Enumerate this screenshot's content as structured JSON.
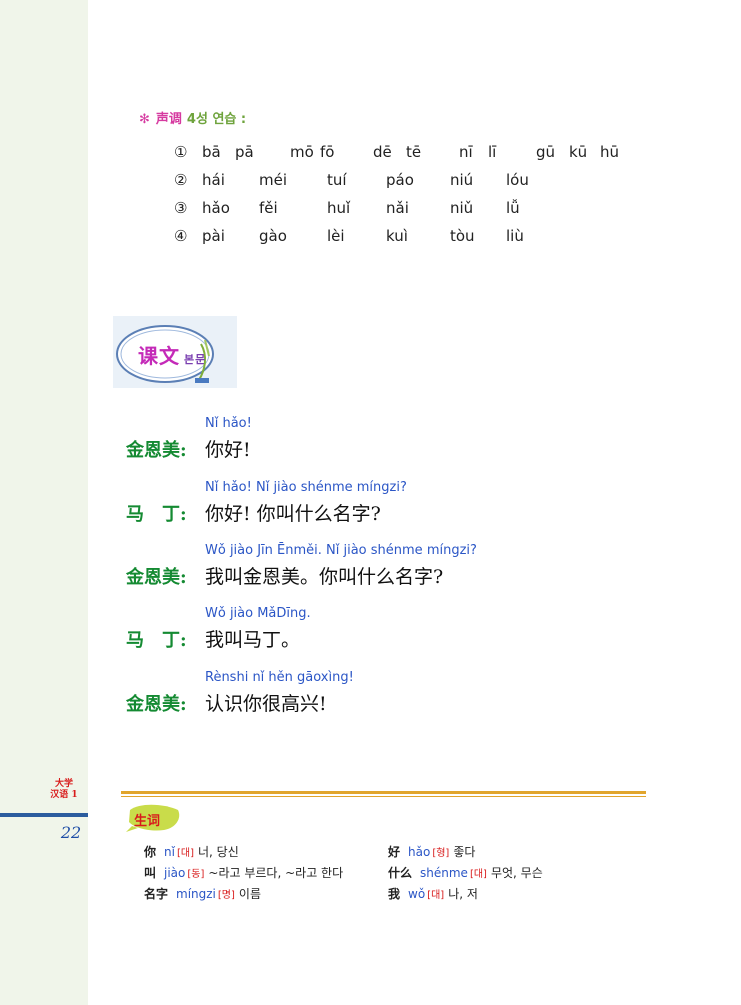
{
  "sidebar": {
    "label_line1": "大学",
    "label_line2": "汉语 1",
    "page_number": "22"
  },
  "tone_practice": {
    "star": "✻",
    "title_cn": "声调",
    "title_kr": "4성 연습 :",
    "rows": [
      {
        "num": "①",
        "items": [
          "bā",
          "pā",
          "mō",
          "fō",
          "dē",
          "tē",
          "nī",
          "lī",
          "gū",
          "kū",
          "hū"
        ]
      },
      {
        "num": "②",
        "items": [
          "hái",
          "méi",
          "tuí",
          "páo",
          "niú",
          "lóu"
        ]
      },
      {
        "num": "③",
        "items": [
          "hǎo",
          "fěi",
          "huǐ",
          "nǎi",
          "niǔ",
          "lǚ"
        ]
      },
      {
        "num": "④",
        "items": [
          "pài",
          "gào",
          "lèi",
          "kuì",
          "tòu",
          "liù"
        ]
      }
    ]
  },
  "text_section": {
    "title_cn": "课文",
    "title_kr": "본문"
  },
  "dialogue": [
    {
      "speaker": "金恩美:",
      "pinyin": "Nǐ hǎo!",
      "hanzi": "你好!"
    },
    {
      "speaker": "马　丁:",
      "pinyin": "Nǐ hǎo! Nǐ jiào shénme míngzi?",
      "hanzi": "你好! 你叫什么名字?"
    },
    {
      "speaker": "金恩美:",
      "pinyin": "Wǒ jiào Jīn Ēnměi. Nǐ jiào shénme míngzi?",
      "hanzi": "我叫金恩美。你叫什么名字?"
    },
    {
      "speaker": "马　丁:",
      "pinyin": "Wǒ jiào MǎDīng.",
      "hanzi": "我叫马丁。"
    },
    {
      "speaker": "金恩美:",
      "pinyin": "Rènshi nǐ hěn gāoxìng!",
      "hanzi": "认识你很高兴!"
    }
  ],
  "vocab_section": {
    "title": "生词",
    "items": [
      {
        "word": "你",
        "pinyin": "nǐ",
        "pos": "[대]",
        "meaning": "너, 당신"
      },
      {
        "word": "好",
        "pinyin": "hǎo",
        "pos": "[형]",
        "meaning": "좋다"
      },
      {
        "word": "叫",
        "pinyin": "jiào",
        "pos": "[동]",
        "meaning": "~라고 부르다, ~라고 한다"
      },
      {
        "word": "什么",
        "pinyin": "shénme",
        "pos": "[대]",
        "meaning": "무엇, 무슨"
      },
      {
        "word": "名字",
        "pinyin": "míngzi",
        "pos": "[명]",
        "meaning": "이름"
      },
      {
        "word": "我",
        "pinyin": "wǒ",
        "pos": "[대]",
        "meaning": "나, 저"
      }
    ]
  }
}
